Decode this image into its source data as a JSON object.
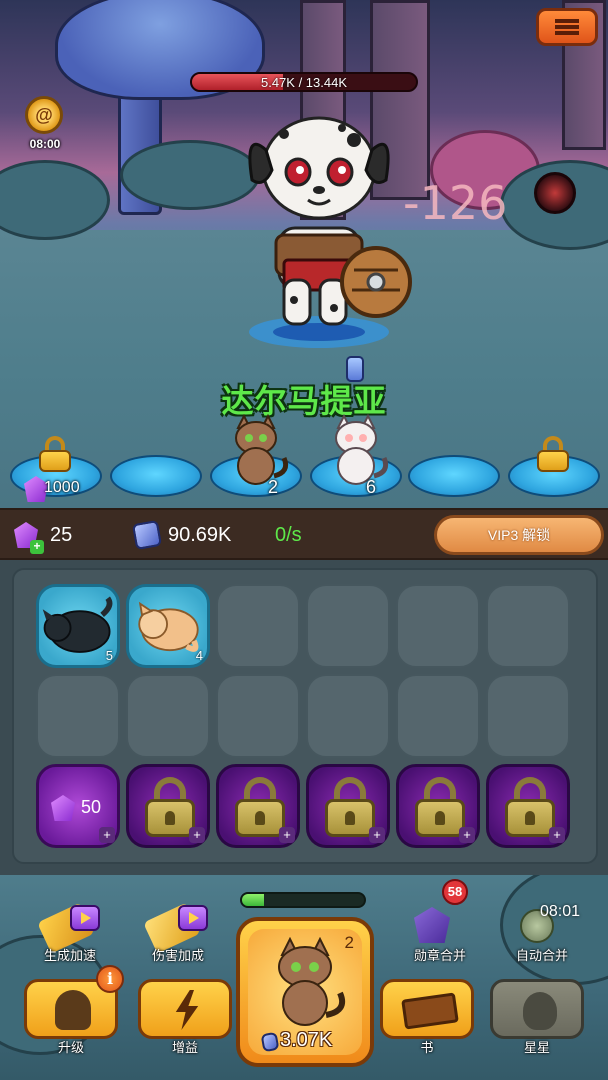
{
  "boss": {
    "timer": "08:00",
    "hp_text": "5.47K / 13.44K",
    "hp_current": 5470,
    "hp_max": 13440,
    "damage_popup": "-126",
    "name": "达尔马提亚"
  },
  "cushions": [
    {
      "state": "locked",
      "cost": "1000"
    },
    {
      "state": "empty"
    },
    {
      "state": "cat",
      "count": "2"
    },
    {
      "state": "cat",
      "count": "6"
    },
    {
      "state": "empty"
    },
    {
      "state": "locked"
    }
  ],
  "resources": {
    "gems": "25",
    "coins": "90.69K",
    "rate": "0/s",
    "vip_button": "VIP3 解锁"
  },
  "grid": {
    "row1": [
      {
        "type": "cat",
        "level": "5",
        "color": "#222a30"
      },
      {
        "type": "cat",
        "level": "4",
        "color": "#f2c08a"
      },
      {
        "type": "empty"
      },
      {
        "type": "empty"
      },
      {
        "type": "empty"
      },
      {
        "type": "empty"
      }
    ],
    "row2": [
      {
        "type": "empty"
      },
      {
        "type": "empty"
      },
      {
        "type": "empty"
      },
      {
        "type": "empty"
      },
      {
        "type": "empty"
      },
      {
        "type": "empty"
      }
    ],
    "row3": [
      {
        "type": "gem-unlock",
        "cost": "50",
        "plus": "+"
      },
      {
        "type": "locked",
        "plus": "+"
      },
      {
        "type": "locked",
        "plus": "+"
      },
      {
        "type": "locked",
        "plus": "+"
      },
      {
        "type": "locked",
        "plus": "+"
      },
      {
        "type": "locked",
        "plus": "+"
      }
    ]
  },
  "features": {
    "speed_up": "生成加速",
    "damage_up": "伤害加成",
    "medal_merge": "勋章合并",
    "medal_badge": "58",
    "auto_merge": "自动合并",
    "auto_merge_timer": "08:01"
  },
  "spawn_progress": 0.18,
  "buy": {
    "level": "2",
    "cost": "3.07K"
  },
  "actions": {
    "upgrade": "升级",
    "boost": "增益",
    "book": "书",
    "stars": "星星",
    "upgrade_info_icon": "i"
  },
  "colors": {
    "hp_red": "#d0323a",
    "name_green": "#5ee84a",
    "rate_green": "#5ee84a",
    "vip_orange": "#e08a44",
    "badge_red": "#e2363a"
  }
}
